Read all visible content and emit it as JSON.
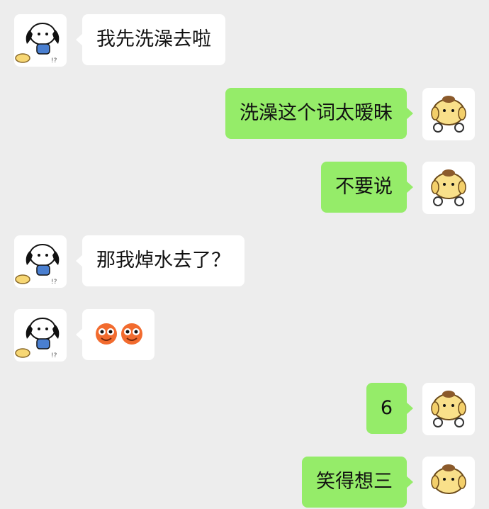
{
  "messages": [
    {
      "side": "left",
      "text": "我先洗澡去啦"
    },
    {
      "side": "right",
      "text": "洗澡这个词太暧昧"
    },
    {
      "side": "right",
      "text": "不要说"
    },
    {
      "side": "left",
      "text": "那我焯水去了？"
    },
    {
      "side": "left",
      "text": "",
      "emoji": [
        "grinning-face-emoji",
        "grinning-face-emoji"
      ]
    },
    {
      "side": "right",
      "text": "6"
    },
    {
      "side": "right",
      "text": "笑得想三"
    }
  ],
  "avatars": {
    "left": "pochacco-avatar",
    "right": "pompompurin-avatar"
  },
  "colors": {
    "background": "#ededed",
    "incoming_bubble": "#ffffff",
    "outgoing_bubble": "#95ec69",
    "text": "#111111"
  }
}
